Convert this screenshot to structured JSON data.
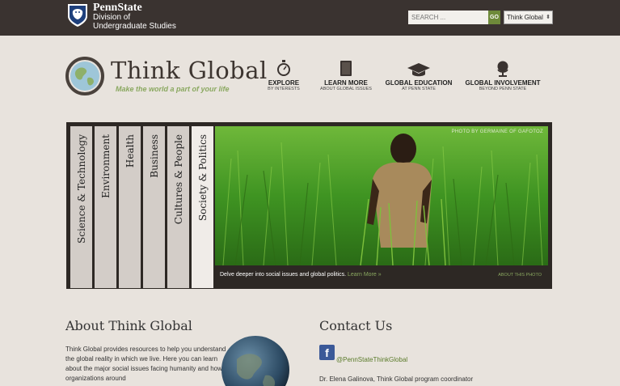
{
  "topbar": {
    "university": "PennState",
    "division_line1": "Division of",
    "division_line2": "Undergraduate Studies",
    "search_placeholder": "SEARCH ...",
    "search_button": "GO",
    "site_select": "Think Global"
  },
  "logo": {
    "title": "Think Global",
    "tagline": "Make the world a part of your life"
  },
  "nav": [
    {
      "label": "EXPLORE",
      "sub": "BY INTERESTS",
      "icon": "compass-icon"
    },
    {
      "label": "LEARN MORE",
      "sub": "ABOUT GLOBAL ISSUES",
      "icon": "book-icon"
    },
    {
      "label": "GLOBAL EDUCATION",
      "sub": "AT PENN STATE",
      "icon": "graduation-cap-icon"
    },
    {
      "label": "GLOBAL INVOLVEMENT",
      "sub": "BEYOND PENN STATE",
      "icon": "globe-stand-icon"
    }
  ],
  "tabs": [
    "Science & Technology",
    "Environment",
    "Health",
    "Business",
    "Cultures & People",
    "Society & Politics"
  ],
  "feature": {
    "photo_credit": "PHOTO BY GERMAINE OF GAFOTOZ",
    "caption": "Delve deeper into social issues and global politics.",
    "caption_link": "Learn More »",
    "about_photo": "ABOUT THIS PHOTO"
  },
  "about": {
    "title": "About Think Global",
    "body": "Think Global provides resources to help you understand the global reality in which we live. Here you can learn about the major social issues facing humanity and how organizations around"
  },
  "contact": {
    "title": "Contact Us",
    "facebook": "@PennStateThinkGlobal",
    "coordinator": "Dr. Elena Galinova, Think Global program coordinator"
  },
  "colors": {
    "topbar": "#3a3330",
    "accent_green": "#6e8a3a",
    "page_bg": "#e8e3dd"
  }
}
